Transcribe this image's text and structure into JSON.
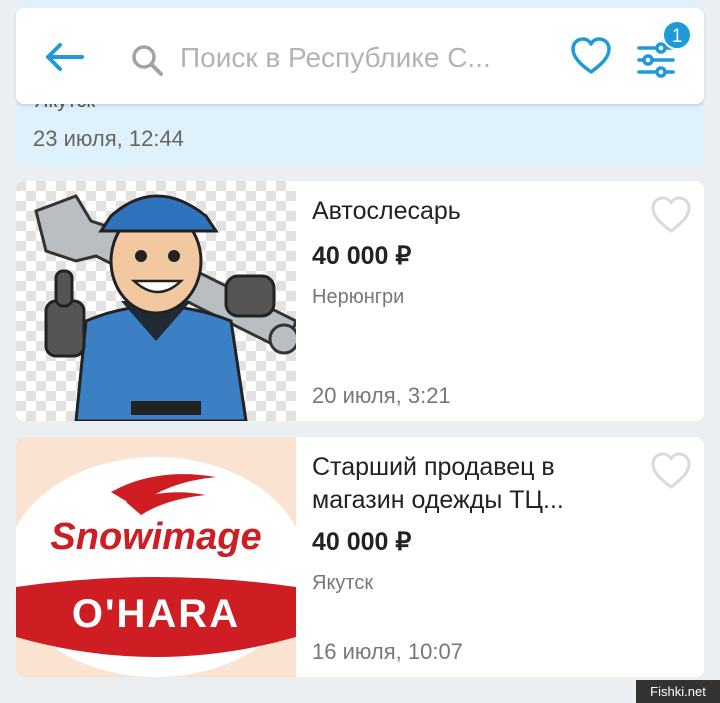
{
  "header": {
    "search_placeholder": "Поиск в Республике С...",
    "filter_badge": "1",
    "icons": [
      "back-arrow-icon",
      "search-icon",
      "heart-icon",
      "filter-sliders-icon"
    ],
    "accent": "#1e9bd7"
  },
  "previous_item": {
    "location_partial": "Якутск",
    "date": "23 июля, 12:44"
  },
  "listings": [
    {
      "title": "Автослесарь",
      "price": "40 000 ₽",
      "city": "Нерюнгри",
      "date": "20 июля, 3:21",
      "image": "mechanic-cartoon"
    },
    {
      "title": "Старший продавец в магазин одежды ТЦ...",
      "price": "40 000 ₽",
      "city": "Якутск",
      "date": "16 июля, 10:07",
      "image": "snowimage-ohara-logo",
      "logo_text_1": "Snowimage",
      "logo_text_2": "O'HARA"
    }
  ],
  "watermark": "Fishki.net"
}
